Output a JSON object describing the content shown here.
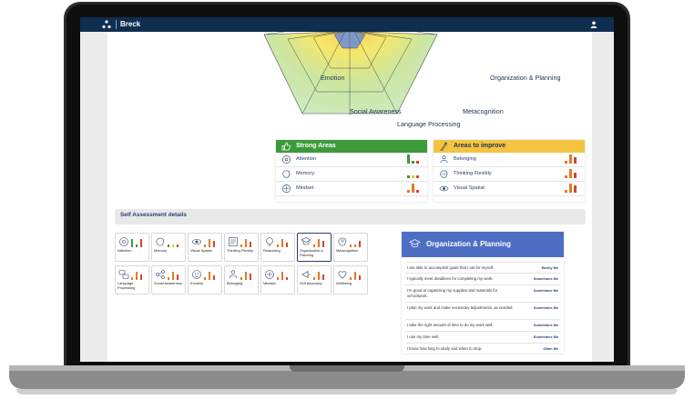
{
  "app": {
    "brand": "Breck"
  },
  "radar": {
    "axes": [
      "Emotion",
      "Organization & Planning",
      "Social Awareness",
      "Metacognition",
      "Language Processing"
    ]
  },
  "strong_areas": {
    "title": "Strong Areas",
    "items": [
      {
        "label": "Attention"
      },
      {
        "label": "Memory"
      },
      {
        "label": "Mindset"
      }
    ]
  },
  "improve_areas": {
    "title": "Areas to improve",
    "items": [
      {
        "label": "Belonging"
      },
      {
        "label": "Thinking Flexibly"
      },
      {
        "label": "Visual Spatial"
      }
    ]
  },
  "self_assessment": {
    "title": "Self Assessment details",
    "tiles": [
      {
        "label": "Attention"
      },
      {
        "label": "Memory"
      },
      {
        "label": "Visual Spatial"
      },
      {
        "label": "Thinking Flexibly"
      },
      {
        "label": "Reasoning"
      },
      {
        "label": "Organization & Planning"
      },
      {
        "label": "Metacognition"
      },
      {
        "label": "Language Processing"
      },
      {
        "label": "Social Awareness"
      },
      {
        "label": "Emotion"
      },
      {
        "label": "Belonging"
      },
      {
        "label": "Mindset"
      },
      {
        "label": "Self Advocacy"
      },
      {
        "label": "Wellbeing"
      }
    ],
    "selected": "Organization & Planning"
  },
  "detail": {
    "title": "Organization & Planning",
    "rows": [
      {
        "q": "I am able to accomplish goals that I set for myself.",
        "a": "Rarely Me"
      },
      {
        "q": "I typically meet deadlines for completing my work.",
        "a": "Sometimes Me"
      },
      {
        "q": "I'm good at organizing my supplies and materials for schoolwork.",
        "a": "Sometimes Me"
      },
      {
        "q": "I plan my work and make necessary adjustments, as needed.",
        "a": "Sometimes Me"
      },
      {
        "q": "I take the right amount of time to do my work well.",
        "a": "Sometimes Me"
      },
      {
        "q": "I use my time well.",
        "a": "Sometimes Me"
      },
      {
        "q": "I know how long to study and when to stop.",
        "a": "Often Me"
      }
    ]
  },
  "colors": {
    "nav": "#0f2d4f",
    "strong": "#3d9a3b",
    "improve": "#f5c342",
    "detail_header": "#4e6ec4",
    "bar_green": "#3a9a3a",
    "bar_orange": "#e07b27",
    "bar_red": "#d8432e",
    "bar_yellow": "#e6c32e"
  }
}
